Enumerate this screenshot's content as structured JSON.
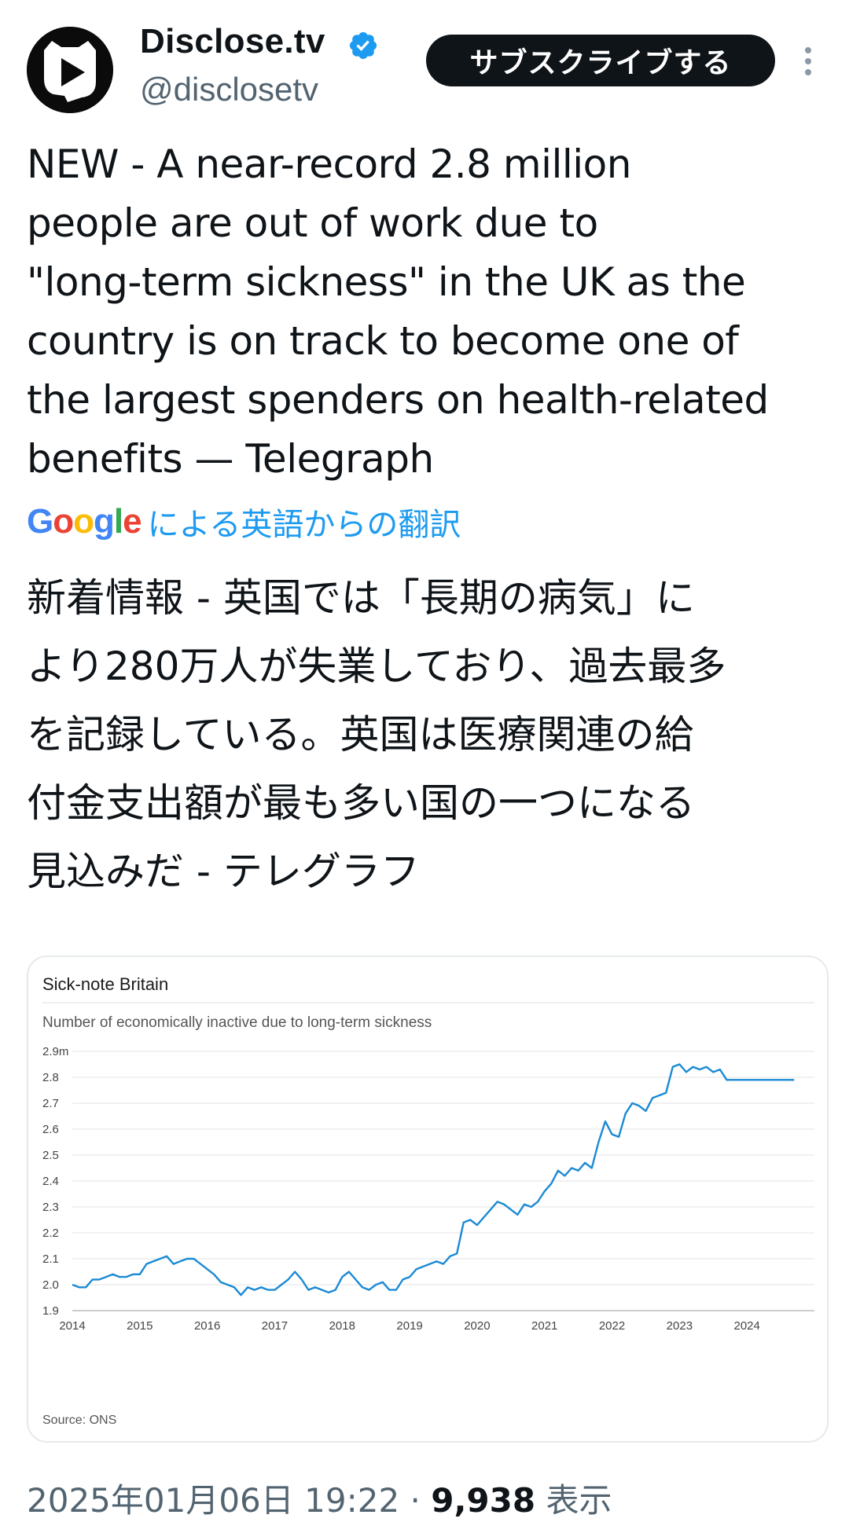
{
  "account": {
    "display_name": "Disclose.tv",
    "handle": "@disclosetv",
    "verified": true,
    "subscribe_label": "サブスクライブする",
    "accent_color": "#1d9bf0"
  },
  "tweet": {
    "text": "NEW - A near-record 2.8 million\npeople are out of work due to\n\"long-term sickness\" in the UK as the\ncountry is on track to become one of\nthe largest spenders on health-related\nbenefits — Telegraph",
    "translate_logo": "Google",
    "translate_label": "による英語からの翻訳",
    "translated_text": "新着情報 - 英国では「長期の病気」に\nより280万人が失業しており、過去最多\nを記録している。英国は医療関連の給\n付金支出額が最も多い国の一つになる\n見込みだ - テレグラフ"
  },
  "footer": {
    "timestamp": "2025年01月06日 19:22",
    "separator": "·",
    "views_count": "9,938",
    "views_label": "表示"
  },
  "chart_data": {
    "type": "line",
    "title": "Sick-note Britain",
    "subtitle": "Number of economically inactive due to long-term sickness",
    "source": "Source: ONS",
    "line_color": "#1a8ad4",
    "grid": true,
    "ylim": [
      1.9,
      2.9
    ],
    "y_ticks": [
      "2.9m",
      "2.8",
      "2.7",
      "2.6",
      "2.5",
      "2.4",
      "2.3",
      "2.2",
      "2.1",
      "2.0",
      "1.9"
    ],
    "x_ticks": [
      "2014",
      "2015",
      "2016",
      "2017",
      "2018",
      "2019",
      "2020",
      "2021",
      "2022",
      "2023",
      "2024"
    ],
    "series": [
      {
        "x": [
          2014.0,
          2014.1,
          2014.2,
          2014.3,
          2014.4,
          2014.5,
          2014.6,
          2014.7,
          2014.8,
          2014.9,
          2015.0,
          2015.1,
          2015.2,
          2015.3,
          2015.4,
          2015.5,
          2015.6,
          2015.7,
          2015.8,
          2015.9,
          2016.0,
          2016.1,
          2016.2,
          2016.3,
          2016.4,
          2016.5,
          2016.6,
          2016.7,
          2016.8,
          2016.9,
          2017.0,
          2017.1,
          2017.2,
          2017.3,
          2017.4,
          2017.5,
          2017.6,
          2017.7,
          2017.8,
          2017.9,
          2018.0,
          2018.1,
          2018.2,
          2018.3,
          2018.4,
          2018.5,
          2018.6,
          2018.7,
          2018.8,
          2018.9,
          2019.0,
          2019.1,
          2019.2,
          2019.3,
          2019.4,
          2019.5,
          2019.6,
          2019.7,
          2019.8,
          2019.9,
          2020.0,
          2020.1,
          2020.2,
          2020.3,
          2020.4,
          2020.5,
          2020.6,
          2020.7,
          2020.8,
          2020.9,
          2021.0,
          2021.1,
          2021.2,
          2021.3,
          2021.4,
          2021.5,
          2021.6,
          2021.7,
          2021.8,
          2021.9,
          2022.0,
          2022.1,
          2022.2,
          2022.3,
          2022.4,
          2022.5,
          2022.6,
          2022.7,
          2022.8,
          2022.9,
          2023.0,
          2023.1,
          2023.2,
          2023.3,
          2023.4,
          2023.5,
          2023.6,
          2023.7,
          2023.8,
          2023.9,
          2024.0,
          2024.1,
          2024.2,
          2024.3,
          2024.4,
          2024.5,
          2024.6,
          2024.7
        ],
        "y": [
          2.0,
          1.99,
          1.99,
          2.02,
          2.02,
          2.03,
          2.04,
          2.03,
          2.03,
          2.04,
          2.04,
          2.08,
          2.09,
          2.1,
          2.11,
          2.08,
          2.09,
          2.1,
          2.1,
          2.08,
          2.06,
          2.04,
          2.01,
          2.0,
          1.99,
          1.96,
          1.99,
          1.98,
          1.99,
          1.98,
          1.98,
          2.0,
          2.02,
          2.05,
          2.02,
          1.98,
          1.99,
          1.98,
          1.97,
          1.98,
          2.03,
          2.05,
          2.02,
          1.99,
          1.98,
          2.0,
          2.01,
          1.98,
          1.98,
          2.02,
          2.03,
          2.06,
          2.07,
          2.08,
          2.09,
          2.08,
          2.11,
          2.12,
          2.24,
          2.25,
          2.23,
          2.26,
          2.29,
          2.32,
          2.31,
          2.29,
          2.27,
          2.31,
          2.3,
          2.32,
          2.36,
          2.39,
          2.44,
          2.42,
          2.45,
          2.44,
          2.47,
          2.45,
          2.55,
          2.63,
          2.58,
          2.57,
          2.66,
          2.7,
          2.69,
          2.67,
          2.72,
          2.73,
          2.74,
          2.84,
          2.85,
          2.82,
          2.84,
          2.83,
          2.84,
          2.82,
          2.83,
          2.79,
          2.79,
          2.79,
          2.79,
          2.79,
          2.79,
          2.79,
          2.79,
          2.79,
          2.79,
          2.79
        ]
      }
    ]
  }
}
